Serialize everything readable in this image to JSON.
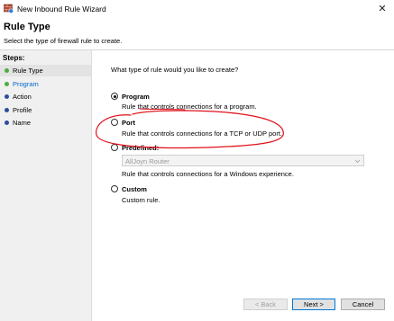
{
  "window": {
    "title": "New Inbound Rule Wizard",
    "close_glyph": "✕"
  },
  "header": {
    "title": "Rule Type",
    "subtitle": "Select the type of firewall rule to create."
  },
  "steps": {
    "title": "Steps:",
    "items": [
      {
        "label": "Rule Type",
        "status": "complete",
        "active": true
      },
      {
        "label": "Program",
        "status": "complete",
        "active": false
      },
      {
        "label": "Action",
        "status": "pending",
        "active": false
      },
      {
        "label": "Profile",
        "status": "pending",
        "active": false
      },
      {
        "label": "Name",
        "status": "pending",
        "active": false
      }
    ]
  },
  "main": {
    "question": "What type of rule would you like to create?",
    "options": [
      {
        "label": "Program",
        "description": "Rule that controls connections for a program.",
        "selected": true
      },
      {
        "label": "Port",
        "description": "Rule that controls connections for a TCP or UDP port.",
        "selected": false
      },
      {
        "label": "Predefined:",
        "description": "Rule that controls connections for a Windows experience.",
        "selected": false
      },
      {
        "label": "Custom",
        "description": "Custom rule.",
        "selected": false
      }
    ],
    "predefined_select": {
      "value": "AllJoyn Router",
      "disabled": true
    }
  },
  "buttons": {
    "back": "< Back",
    "next": "Next >",
    "cancel": "Cancel"
  },
  "colors": {
    "step_complete": "#4cae3e",
    "step_pending": "#2e4c9c",
    "link": "#0066cc",
    "annotation": "#e0101a"
  }
}
